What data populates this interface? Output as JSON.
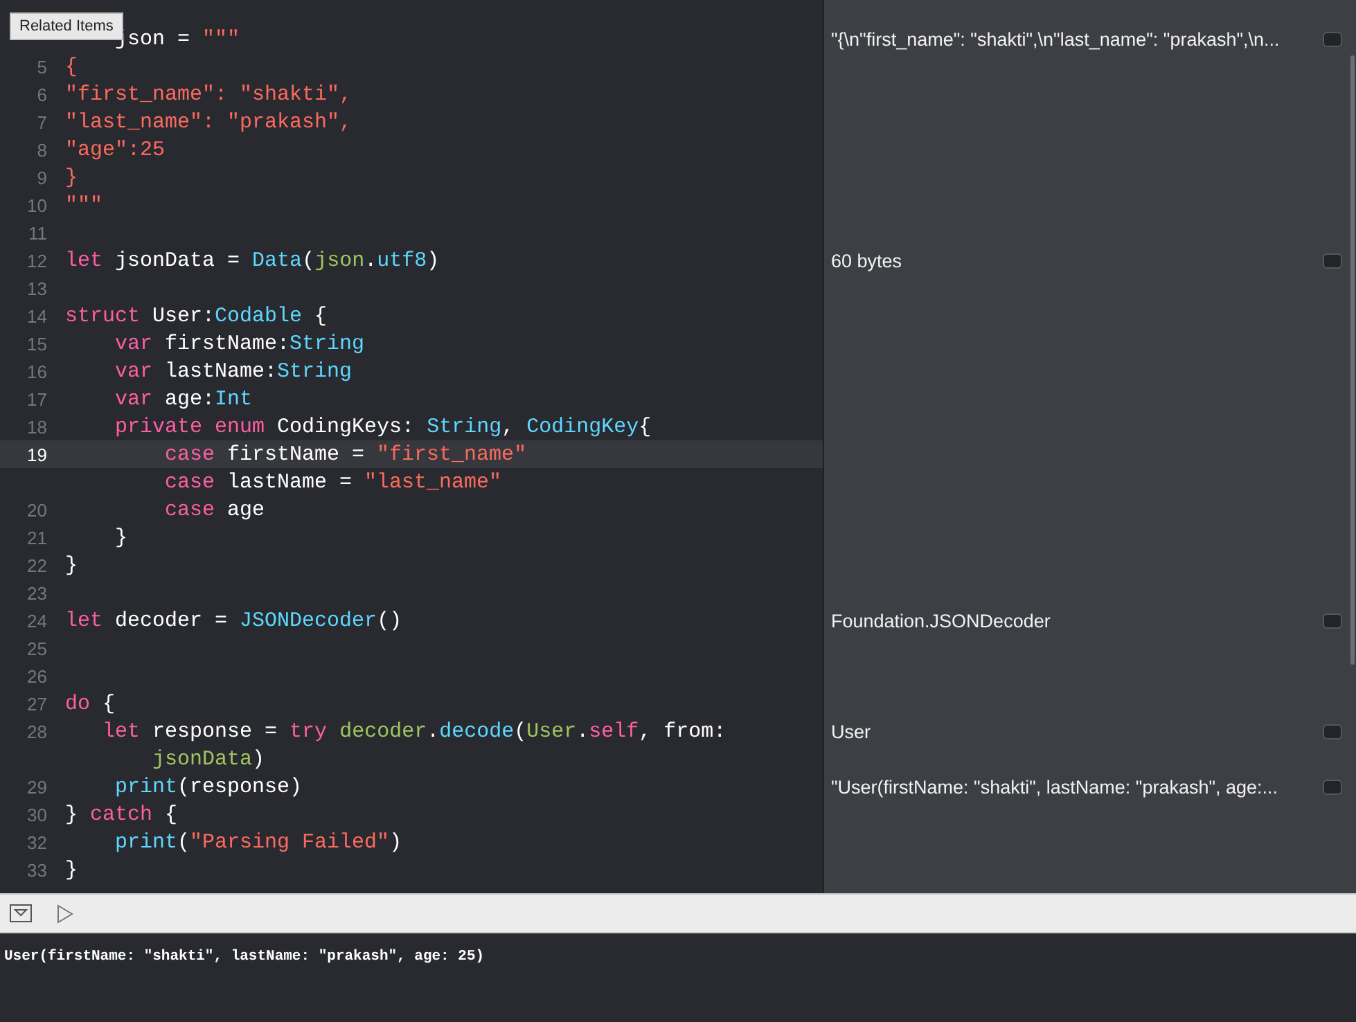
{
  "tooltip": "Related Items",
  "lines": [
    {
      "kind": "block",
      "current": false,
      "result": "\"{\\n\"first_name\": \"shakti\",\\n\"last_name\": \"prakash\",\\n...",
      "tokens": [
        {
          "kind": "plain",
          "text": "json = "
        },
        {
          "kind": "str",
          "text": "\"\"\""
        }
      ]
    },
    {
      "number": "5",
      "kind": "flush",
      "current": false,
      "tokens": [
        {
          "kind": "str",
          "text": "{"
        }
      ]
    },
    {
      "number": "6",
      "kind": "flush",
      "current": false,
      "tokens": [
        {
          "kind": "str",
          "text": "\"first_name\": \"shakti\","
        }
      ]
    },
    {
      "number": "7",
      "kind": "flush",
      "current": false,
      "tokens": [
        {
          "kind": "str",
          "text": "\"last_name\": \"prakash\","
        }
      ]
    },
    {
      "number": "8",
      "kind": "flush",
      "current": false,
      "tokens": [
        {
          "kind": "str",
          "text": "\"age\":25"
        }
      ]
    },
    {
      "number": "9",
      "kind": "flush",
      "current": false,
      "tokens": [
        {
          "kind": "str",
          "text": "}"
        }
      ]
    },
    {
      "number": "10",
      "kind": "flush",
      "current": false,
      "tokens": [
        {
          "kind": "str",
          "text": "\"\"\""
        }
      ]
    },
    {
      "number": "11",
      "current": false
    },
    {
      "number": "12",
      "kind": "flush",
      "current": false,
      "result": "60 bytes",
      "tokens": [
        {
          "kind": "kw",
          "text": "let"
        },
        {
          "kind": "plain",
          "text": " jsonData = "
        },
        {
          "kind": "type",
          "text": "Data"
        },
        {
          "kind": "plain",
          "text": "("
        },
        {
          "kind": "proj",
          "text": "json"
        },
        {
          "kind": "plain",
          "text": "."
        },
        {
          "kind": "type",
          "text": "utf8"
        },
        {
          "kind": "plain",
          "text": ")"
        }
      ]
    },
    {
      "number": "13",
      "current": false
    },
    {
      "number": "14",
      "kind": "flush",
      "current": false,
      "tokens": [
        {
          "kind": "kw",
          "text": "struct"
        },
        {
          "kind": "plain",
          "text": " User:"
        },
        {
          "kind": "type",
          "text": "Codable"
        },
        {
          "kind": "plain",
          "text": " {"
        }
      ]
    },
    {
      "number": "15",
      "kind": "block",
      "current": false,
      "tokens": [
        {
          "kind": "kw",
          "text": "var"
        },
        {
          "kind": "plain",
          "text": " firstName:"
        },
        {
          "kind": "type",
          "text": "String"
        }
      ]
    },
    {
      "number": "16",
      "kind": "block",
      "current": false,
      "tokens": [
        {
          "kind": "kw",
          "text": "var"
        },
        {
          "kind": "plain",
          "text": " lastName:"
        },
        {
          "kind": "type",
          "text": "String"
        }
      ]
    },
    {
      "number": "17",
      "kind": "block",
      "current": false,
      "tokens": [
        {
          "kind": "kw",
          "text": "var"
        },
        {
          "kind": "plain",
          "text": " age:"
        },
        {
          "kind": "type",
          "text": "Int"
        }
      ]
    },
    {
      "number": "18",
      "kind": "block",
      "current": false,
      "tokens": [
        {
          "kind": "kw",
          "text": "private enum"
        },
        {
          "kind": "plain",
          "text": " CodingKeys: "
        },
        {
          "kind": "type",
          "text": "String"
        },
        {
          "kind": "plain",
          "text": ", "
        },
        {
          "kind": "type",
          "text": "CodingKey"
        },
        {
          "kind": "plain",
          "text": "{"
        }
      ]
    },
    {
      "number": "19",
      "kind": "inner",
      "current": true,
      "tokens": [
        {
          "kind": "kw",
          "text": "case"
        },
        {
          "kind": "plain",
          "text": " firstName = "
        },
        {
          "kind": "str",
          "text": "\"first_name\""
        }
      ]
    },
    {
      "kind": "inner",
      "current": false,
      "tokens": [
        {
          "kind": "kw",
          "text": "case"
        },
        {
          "kind": "plain",
          "text": " lastName = "
        },
        {
          "kind": "str",
          "text": "\"last_name\""
        }
      ]
    },
    {
      "number": "20",
      "kind": "inner",
      "current": false,
      "tokens": [
        {
          "kind": "kw",
          "text": "case"
        },
        {
          "kind": "plain",
          "text": " age"
        }
      ]
    },
    {
      "number": "21",
      "kind": "block",
      "current": false,
      "tokens": [
        {
          "kind": "plain",
          "text": "}"
        }
      ]
    },
    {
      "number": "22",
      "kind": "flush",
      "current": false,
      "tokens": [
        {
          "kind": "plain",
          "text": "}"
        }
      ]
    },
    {
      "number": "23",
      "current": false
    },
    {
      "number": "24",
      "kind": "flush",
      "current": false,
      "result": "Foundation.JSONDecoder",
      "tokens": [
        {
          "kind": "kw",
          "text": "let"
        },
        {
          "kind": "plain",
          "text": " decoder = "
        },
        {
          "kind": "type",
          "text": "JSONDecoder"
        },
        {
          "kind": "plain",
          "text": "()"
        }
      ]
    },
    {
      "number": "25",
      "current": false
    },
    {
      "number": "26",
      "current": false
    },
    {
      "number": "27",
      "kind": "flush",
      "current": false,
      "tokens": [
        {
          "kind": "kw",
          "text": "do"
        },
        {
          "kind": "plain",
          "text": " {"
        }
      ]
    },
    {
      "number": "28",
      "kind": "short",
      "current": false,
      "result": "User",
      "tokens": [
        {
          "kind": "kw",
          "text": "let"
        },
        {
          "kind": "plain",
          "text": " response = "
        },
        {
          "kind": "kw",
          "text": "try "
        },
        {
          "kind": "proj",
          "text": "decoder"
        },
        {
          "kind": "plain",
          "text": "."
        },
        {
          "kind": "type",
          "text": "decode"
        },
        {
          "kind": "plain",
          "text": "("
        },
        {
          "kind": "proj",
          "text": "User"
        },
        {
          "kind": "plain",
          "text": "."
        },
        {
          "kind": "kw",
          "text": "self"
        },
        {
          "kind": "plain",
          "text": ", from:"
        }
      ]
    },
    {
      "kind": "wrap",
      "current": false,
      "tokens": [
        {
          "kind": "proj",
          "text": "jsonData"
        },
        {
          "kind": "plain",
          "text": ")"
        }
      ]
    },
    {
      "number": "29",
      "kind": "block",
      "current": false,
      "result": "\"User(firstName: \"shakti\", lastName: \"prakash\", age:...",
      "tokens": [
        {
          "kind": "type",
          "text": "print"
        },
        {
          "kind": "plain",
          "text": "(response)"
        }
      ]
    },
    {
      "number": "30",
      "kind": "flush",
      "current": false,
      "tokens": [
        {
          "kind": "plain",
          "text": "} "
        },
        {
          "kind": "kw",
          "text": "catch"
        },
        {
          "kind": "plain",
          "text": " {"
        }
      ]
    },
    {
      "number": "32",
      "kind": "block",
      "current": false,
      "tokens": [
        {
          "kind": "type",
          "text": "print"
        },
        {
          "kind": "plain",
          "text": "("
        },
        {
          "kind": "str",
          "text": "\"Parsing Failed\""
        },
        {
          "kind": "plain",
          "text": ")"
        }
      ]
    },
    {
      "number": "33",
      "kind": "flush",
      "current": false,
      "tokens": [
        {
          "kind": "plain",
          "text": "}"
        }
      ]
    }
  ],
  "console_output": "User(firstName: \"shakti\", lastName: \"prakash\", age: 25)"
}
